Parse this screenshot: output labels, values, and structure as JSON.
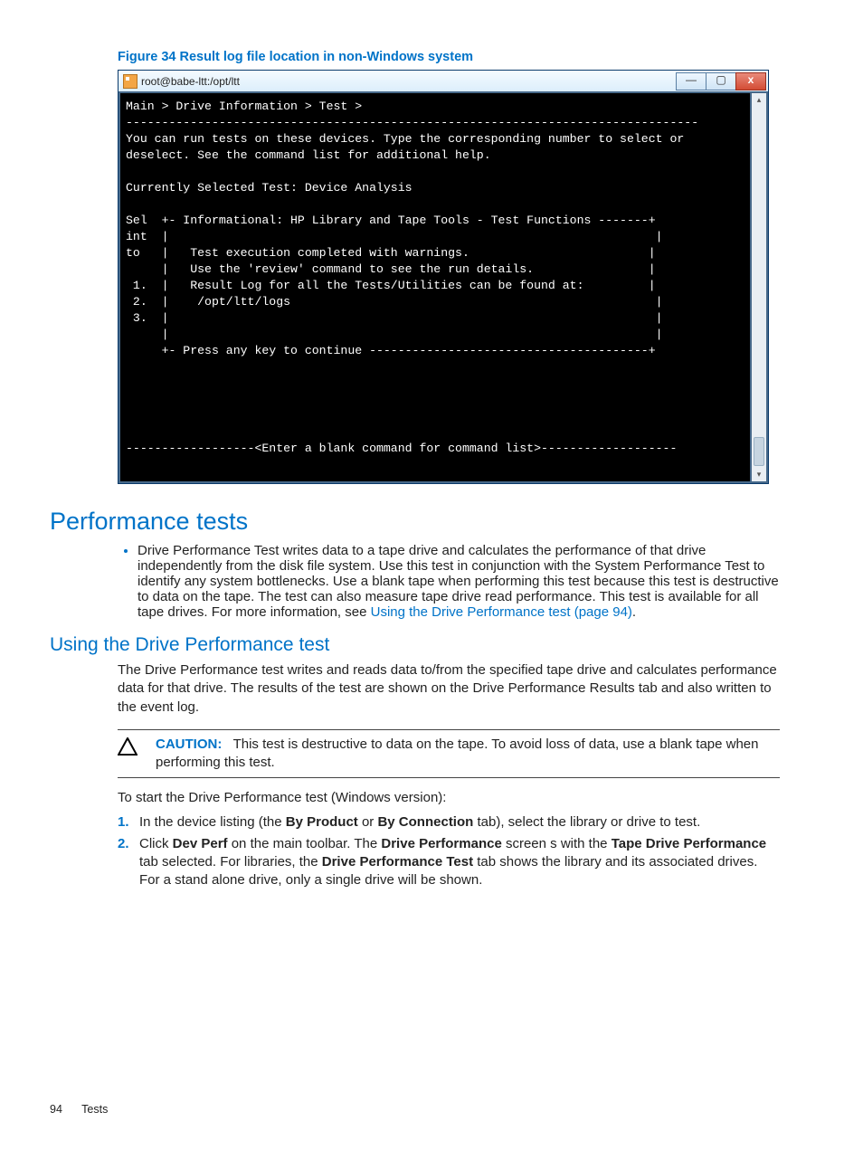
{
  "figure": {
    "caption": "Figure 34 Result log file location in non-Windows system"
  },
  "terminal": {
    "title": "root@babe-ltt:/opt/ltt",
    "buttons": {
      "min": "—",
      "max": "▢",
      "close": "x"
    },
    "lines": "Main > Drive Information > Test >\n--------------------------------------------------------------------------------\nYou can run tests on these devices. Type the corresponding number to select or\ndeselect. See the command list for additional help.\n\nCurrently Selected Test: Device Analysis\n\nSel  +- Informational: HP Library and Tape Tools - Test Functions -------+\nint  |                                                                    |\nto   |   Test execution completed with warnings.                         |\n     |   Use the 'review' command to see the run details.                |\n 1.  |   Result Log for all the Tests/Utilities can be found at:         |\n 2.  |    /opt/ltt/logs                                                   |\n 3.  |                                                                    |\n     |                                                                    |\n     +- Press any key to continue ---------------------------------------+\n\n\n\n\n\n------------------<Enter a blank command for command list>-------------------"
  },
  "section": {
    "title": "Performance tests",
    "bullet_text_before_link": "Drive Performance Test writes data to a tape drive and calculates the performance of that drive independently from the disk file system. Use this test in conjunction with the System Performance Test to identify any system bottlenecks. Use a blank tape when performing this test because this test is destructive to data on the tape. The test can also measure tape drive read performance. This test is available for all tape drives. For more information, see ",
    "link_text": "Using the Drive Performance test (page 94)",
    "bullet_text_after_link": "."
  },
  "subsection": {
    "title": "Using the Drive Performance test",
    "intro": "The Drive Performance test writes and reads data to/from the specified tape drive and calculates performance data for that drive. The results of the test are shown on the Drive Performance Results tab and also written to the event log."
  },
  "caution": {
    "label": "CAUTION:",
    "text": "This test is destructive to data on the tape. To avoid loss of data, use a blank tape when performing this test."
  },
  "procedure": {
    "lead": "To start the Drive Performance test (Windows version):",
    "step1": {
      "t0": "In the device listing (the ",
      "b1": "By Product",
      "t1": " or ",
      "b2": "By Connection",
      "t2": " tab), select the library or drive to test."
    },
    "step2": {
      "t0": "Click ",
      "b1": "Dev Perf",
      "t1": " on the main toolbar. The ",
      "b2": "Drive Performance",
      "t2": " screen s with the ",
      "b3": "Tape Drive Performance",
      "t3": " tab selected. For libraries, the ",
      "b4": "Drive Performance Test",
      "t4": " tab shows the library and its associated drives. For a stand alone drive, only a single drive will be shown."
    }
  },
  "footer": {
    "page": "94",
    "section": "Tests"
  }
}
